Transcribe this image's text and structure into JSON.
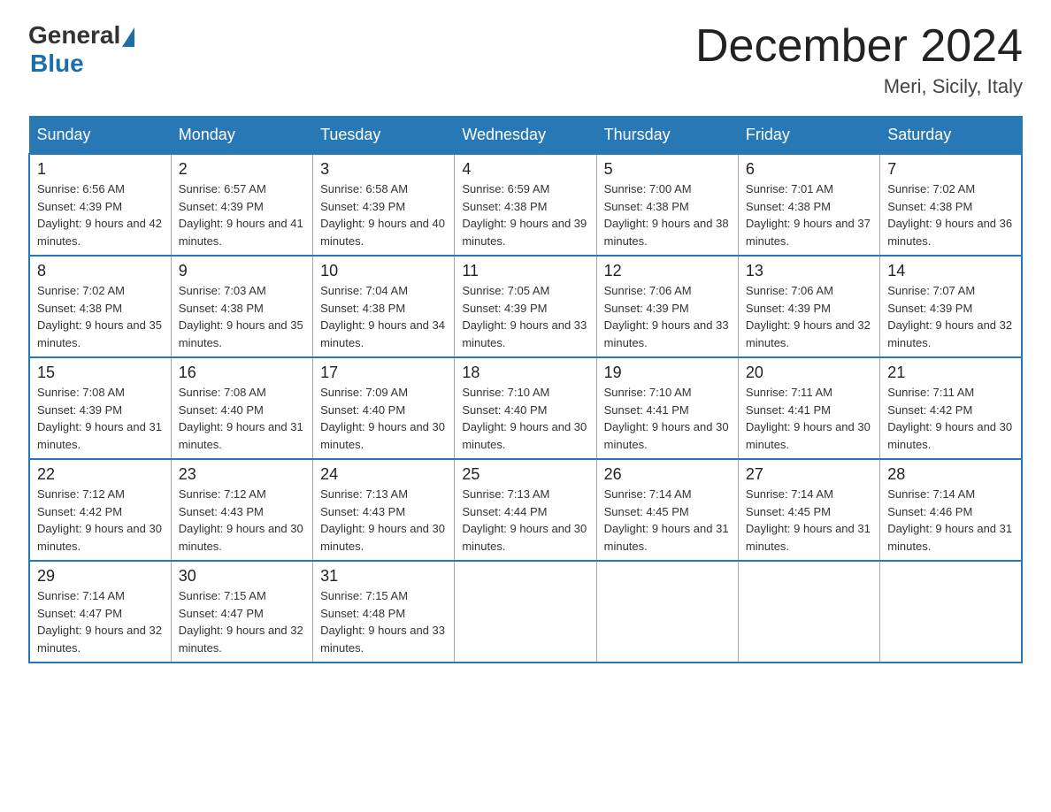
{
  "logo": {
    "general": "General",
    "blue": "Blue"
  },
  "title": "December 2024",
  "subtitle": "Meri, Sicily, Italy",
  "days_of_week": [
    "Sunday",
    "Monday",
    "Tuesday",
    "Wednesday",
    "Thursday",
    "Friday",
    "Saturday"
  ],
  "weeks": [
    [
      {
        "day": "1",
        "sunrise": "6:56 AM",
        "sunset": "4:39 PM",
        "daylight": "9 hours and 42 minutes."
      },
      {
        "day": "2",
        "sunrise": "6:57 AM",
        "sunset": "4:39 PM",
        "daylight": "9 hours and 41 minutes."
      },
      {
        "day": "3",
        "sunrise": "6:58 AM",
        "sunset": "4:39 PM",
        "daylight": "9 hours and 40 minutes."
      },
      {
        "day": "4",
        "sunrise": "6:59 AM",
        "sunset": "4:38 PM",
        "daylight": "9 hours and 39 minutes."
      },
      {
        "day": "5",
        "sunrise": "7:00 AM",
        "sunset": "4:38 PM",
        "daylight": "9 hours and 38 minutes."
      },
      {
        "day": "6",
        "sunrise": "7:01 AM",
        "sunset": "4:38 PM",
        "daylight": "9 hours and 37 minutes."
      },
      {
        "day": "7",
        "sunrise": "7:02 AM",
        "sunset": "4:38 PM",
        "daylight": "9 hours and 36 minutes."
      }
    ],
    [
      {
        "day": "8",
        "sunrise": "7:02 AM",
        "sunset": "4:38 PM",
        "daylight": "9 hours and 35 minutes."
      },
      {
        "day": "9",
        "sunrise": "7:03 AM",
        "sunset": "4:38 PM",
        "daylight": "9 hours and 35 minutes."
      },
      {
        "day": "10",
        "sunrise": "7:04 AM",
        "sunset": "4:38 PM",
        "daylight": "9 hours and 34 minutes."
      },
      {
        "day": "11",
        "sunrise": "7:05 AM",
        "sunset": "4:39 PM",
        "daylight": "9 hours and 33 minutes."
      },
      {
        "day": "12",
        "sunrise": "7:06 AM",
        "sunset": "4:39 PM",
        "daylight": "9 hours and 33 minutes."
      },
      {
        "day": "13",
        "sunrise": "7:06 AM",
        "sunset": "4:39 PM",
        "daylight": "9 hours and 32 minutes."
      },
      {
        "day": "14",
        "sunrise": "7:07 AM",
        "sunset": "4:39 PM",
        "daylight": "9 hours and 32 minutes."
      }
    ],
    [
      {
        "day": "15",
        "sunrise": "7:08 AM",
        "sunset": "4:39 PM",
        "daylight": "9 hours and 31 minutes."
      },
      {
        "day": "16",
        "sunrise": "7:08 AM",
        "sunset": "4:40 PM",
        "daylight": "9 hours and 31 minutes."
      },
      {
        "day": "17",
        "sunrise": "7:09 AM",
        "sunset": "4:40 PM",
        "daylight": "9 hours and 30 minutes."
      },
      {
        "day": "18",
        "sunrise": "7:10 AM",
        "sunset": "4:40 PM",
        "daylight": "9 hours and 30 minutes."
      },
      {
        "day": "19",
        "sunrise": "7:10 AM",
        "sunset": "4:41 PM",
        "daylight": "9 hours and 30 minutes."
      },
      {
        "day": "20",
        "sunrise": "7:11 AM",
        "sunset": "4:41 PM",
        "daylight": "9 hours and 30 minutes."
      },
      {
        "day": "21",
        "sunrise": "7:11 AM",
        "sunset": "4:42 PM",
        "daylight": "9 hours and 30 minutes."
      }
    ],
    [
      {
        "day": "22",
        "sunrise": "7:12 AM",
        "sunset": "4:42 PM",
        "daylight": "9 hours and 30 minutes."
      },
      {
        "day": "23",
        "sunrise": "7:12 AM",
        "sunset": "4:43 PM",
        "daylight": "9 hours and 30 minutes."
      },
      {
        "day": "24",
        "sunrise": "7:13 AM",
        "sunset": "4:43 PM",
        "daylight": "9 hours and 30 minutes."
      },
      {
        "day": "25",
        "sunrise": "7:13 AM",
        "sunset": "4:44 PM",
        "daylight": "9 hours and 30 minutes."
      },
      {
        "day": "26",
        "sunrise": "7:14 AM",
        "sunset": "4:45 PM",
        "daylight": "9 hours and 31 minutes."
      },
      {
        "day": "27",
        "sunrise": "7:14 AM",
        "sunset": "4:45 PM",
        "daylight": "9 hours and 31 minutes."
      },
      {
        "day": "28",
        "sunrise": "7:14 AM",
        "sunset": "4:46 PM",
        "daylight": "9 hours and 31 minutes."
      }
    ],
    [
      {
        "day": "29",
        "sunrise": "7:14 AM",
        "sunset": "4:47 PM",
        "daylight": "9 hours and 32 minutes."
      },
      {
        "day": "30",
        "sunrise": "7:15 AM",
        "sunset": "4:47 PM",
        "daylight": "9 hours and 32 minutes."
      },
      {
        "day": "31",
        "sunrise": "7:15 AM",
        "sunset": "4:48 PM",
        "daylight": "9 hours and 33 minutes."
      },
      null,
      null,
      null,
      null
    ]
  ]
}
